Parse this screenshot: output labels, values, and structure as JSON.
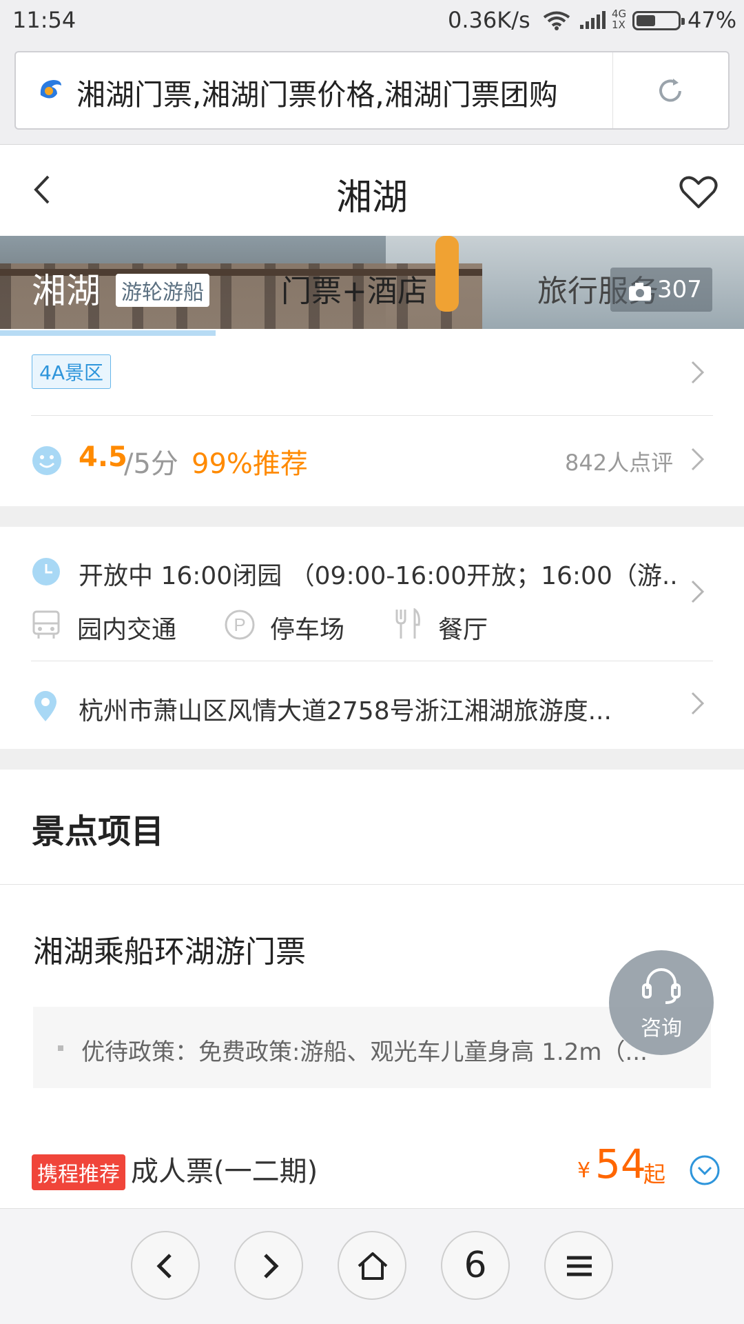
{
  "status_bar": {
    "time": "11:54",
    "speed": "0.36K/s",
    "network_top": "4G",
    "network_bottom": "1X",
    "battery_percent": "47%",
    "battery_level": 0.47
  },
  "url_bar": {
    "title": "湘湖门票,湘湖门票价格,湘湖门票团购"
  },
  "header": {
    "title": "湘湖"
  },
  "banner": {
    "tab_main": "湘湖",
    "chip": "游轮游船",
    "tab_ticket_hotel": "门票+酒店",
    "tab_travel": "旅行服务",
    "photo_count": "307",
    "scroll_progress": 0.29
  },
  "badge": "4A景区",
  "rating": {
    "score": "4.5",
    "out_of": "/5分",
    "recommend": "99%推荐",
    "reviews": "842人点评"
  },
  "hours": {
    "text": "开放中 16:00闭园 （09:00-16:00开放；16:00（游..."
  },
  "facilities": [
    {
      "label": "园内交通",
      "icon": "bus-icon"
    },
    {
      "label": "停车场",
      "icon": "parking-icon"
    },
    {
      "label": "餐厅",
      "icon": "restaurant-icon"
    }
  ],
  "address": "杭州市萧山区风情大道2758号浙江湘湖旅游度...",
  "section_title": "景点项目",
  "product": {
    "title": "湘湖乘船环湖游门票",
    "policy": "优待政策：免费政策:游船、观光车儿童身高 1.2m（..."
  },
  "ticket": {
    "tag": "携程推荐",
    "name": "成人票(一二期)",
    "currency": "¥",
    "price": "54",
    "suffix": "起"
  },
  "consult_label": "咨询",
  "bottom_nav": {
    "tabs_count": "6"
  },
  "colors": {
    "accent_orange": "#ff8a00",
    "price_orange": "#ff6600",
    "tag_red": "#f0453a",
    "blue": "#2e95db"
  }
}
